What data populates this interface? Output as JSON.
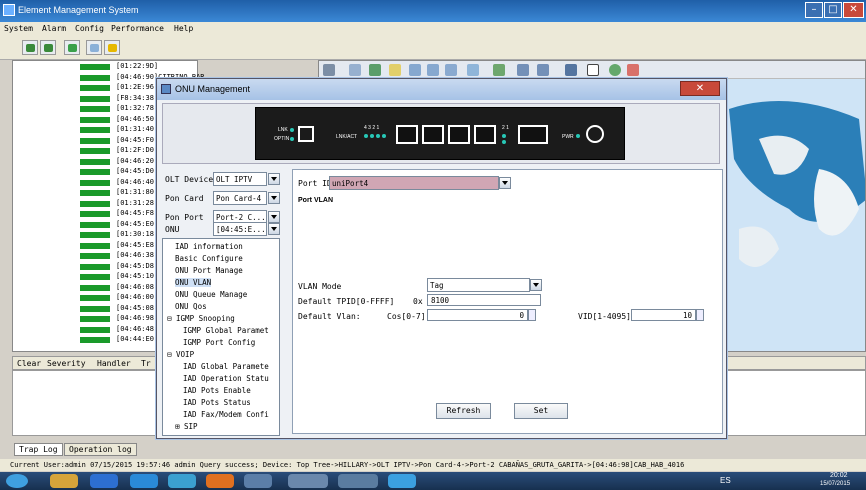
{
  "app": {
    "title": "Element Management System"
  },
  "menu": [
    "System",
    "Alarm",
    "Config",
    "Performance",
    "Help"
  ],
  "tree_rows": [
    "[01:22:9D]",
    "[04:46:90]CITRINO BAR",
    "[01:2E:96]",
    "[F8:34:38]",
    "[01:32:78]",
    "[04:46:50]",
    "[01:31:40]",
    "[04:45:F0]",
    "[01:2F:D0]",
    "[04:46:20]",
    "[04:45:D0]",
    "[04:46:40]",
    "[01:31:80]",
    "[01:31:28]",
    "[04:45:F8]",
    "[04:45:E0]",
    "[01:30:18]",
    "[04:45:E8]",
    "[04:46:38]",
    "[04:45:D8]",
    "[04:45:10]",
    "[04:46:08]",
    "[04:46:00]",
    "[04:45:08]",
    "[04:46:98]",
    "[04:46:48]",
    "[04:44:E0]"
  ],
  "alarm_columns": [
    "Clear",
    "Severity",
    "Handler",
    "Tr"
  ],
  "bottom_tabs": [
    "Trap Log",
    "Operation log"
  ],
  "status": "Current User:admin   07/15/2015 19:57:46  admin  Query  success; Device: Top Tree->HILLARY->OLT IPTV->Pon Card-4->Port-2 CABAÑAS_GRUTA_GARITA->[04:46:98]CAB_HAB_4016",
  "dialog": {
    "title": "ONU Management",
    "device_panel": {
      "link_label": "LNK",
      "optin_label": "OPTIN",
      "lnkact_label": "LNK/ACT",
      "pwr_label": "PWR",
      "port_nums": "4 3 2 1",
      "port_nums2": "2 1"
    },
    "selectors": [
      {
        "label": "OLT Device",
        "value": "OLT IPTV"
      },
      {
        "label": "Pon Card",
        "value": "Pon Card-4"
      },
      {
        "label": "Pon Port",
        "value": "Port-2 C..."
      },
      {
        "label": "ONU",
        "value": "[04:45:E..."
      }
    ],
    "functions": [
      {
        "label": "IAD information",
        "indent": 1
      },
      {
        "label": "Basic Configure",
        "indent": 1
      },
      {
        "label": "ONU Port Manage",
        "indent": 1
      },
      {
        "label": "ONU VLAN",
        "indent": 1,
        "selected": true
      },
      {
        "label": "ONU Queue Manage",
        "indent": 1
      },
      {
        "label": "ONU Qos",
        "indent": 1
      },
      {
        "label": "IGMP Snooping",
        "indent": 0,
        "expander": "⊟"
      },
      {
        "label": "IGMP Global Paramet",
        "indent": 2
      },
      {
        "label": "IGMP Port Config",
        "indent": 2
      },
      {
        "label": "VOIP",
        "indent": 0,
        "expander": "⊟"
      },
      {
        "label": "IAD Global Paramete",
        "indent": 2
      },
      {
        "label": "IAD Operation Statu",
        "indent": 2
      },
      {
        "label": "IAD Pots Enable",
        "indent": 2
      },
      {
        "label": "IAD Pots Status",
        "indent": 2
      },
      {
        "label": "IAD Fax/Modem Confi",
        "indent": 2
      },
      {
        "label": "SIP",
        "indent": 1,
        "expander": "⊞"
      }
    ],
    "port_id": {
      "label": "Port ID",
      "value": "uniPort4"
    },
    "section": "Port VLAN",
    "vlan_mode": {
      "label": "VLAN Mode",
      "value": "Tag"
    },
    "tpid": {
      "label": "Default TPID[0-FFFF]",
      "prefix": "0x",
      "value": "8100"
    },
    "vlan": {
      "label": "Default Vlan:",
      "cos_label": "Cos[0-7]",
      "cos_value": "0",
      "vid_label": "VID[1-4095]",
      "vid_value": "10"
    },
    "buttons": {
      "refresh": "Refresh",
      "set": "Set"
    }
  },
  "tray": {
    "lang": "ES",
    "time": "20:02",
    "date": "15/07/2015"
  }
}
